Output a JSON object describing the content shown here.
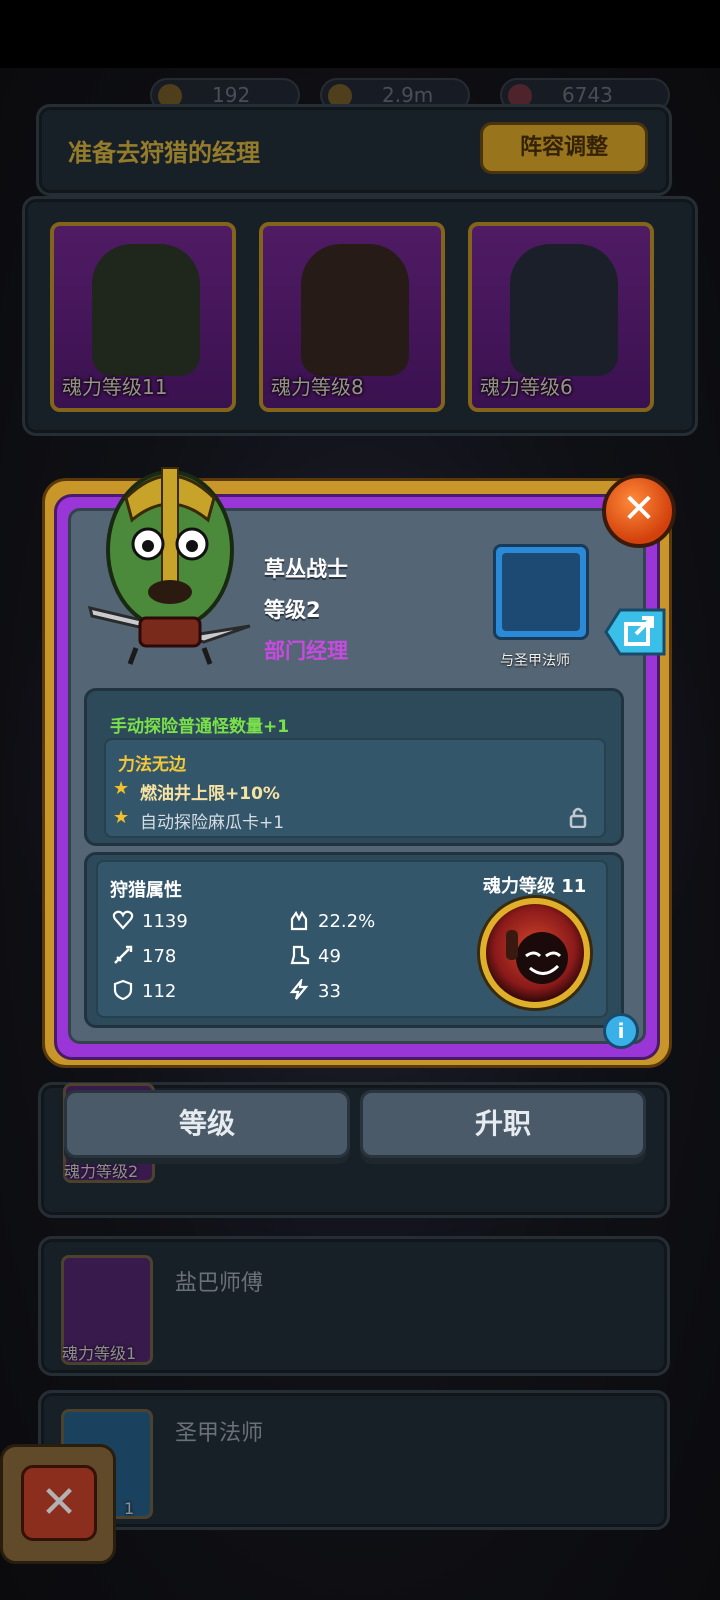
{
  "header": {
    "title": "准备去狩猎的经理",
    "lineup_button": "阵容调整"
  },
  "resources": [
    {
      "value": "192"
    },
    {
      "value": "2.9m"
    },
    {
      "value": "6743"
    }
  ],
  "team_slots": [
    {
      "label": "魂力等级11"
    },
    {
      "label": "魂力等级8"
    },
    {
      "label": "魂力等级6"
    }
  ],
  "modal": {
    "hero_name": "草丛战士",
    "hero_level": "等级2",
    "hero_rank": "部门经理",
    "partner_label": "与圣甲法师",
    "skill_bonus": "手动探险普通怪数量+1",
    "skill_title": "力法无边",
    "skill_items": [
      "燃油井上限+10%",
      "自动探险麻瓜卡+1"
    ],
    "stats_title": "狩猎属性",
    "stats": [
      {
        "icon": "heart-icon",
        "value": "1139"
      },
      {
        "icon": "crit-icon",
        "value": "22.2%"
      },
      {
        "icon": "sword-icon",
        "value": "178"
      },
      {
        "icon": "boot-icon",
        "value": "49"
      },
      {
        "icon": "shield-icon",
        "value": "112"
      },
      {
        "icon": "lightning-icon",
        "value": "33"
      }
    ],
    "soul_level": "魂力等级 11",
    "info_symbol": "i",
    "close_symbol": "✕"
  },
  "tabs": {
    "level": "等级",
    "promote": "升职"
  },
  "list": [
    {
      "thumb_label": "魂力等级2",
      "name": ""
    },
    {
      "thumb_label": "魂力等级1",
      "name": "盐巴师傅"
    },
    {
      "thumb_label": "1",
      "name": "圣甲法师"
    }
  ],
  "back_symbol": "✕",
  "colors": {
    "gold": "#c9962a",
    "purple": "#9a36d8",
    "green_text": "#7ae04a",
    "yellow_text": "#f2c83a",
    "rank": "#c84ae0"
  }
}
